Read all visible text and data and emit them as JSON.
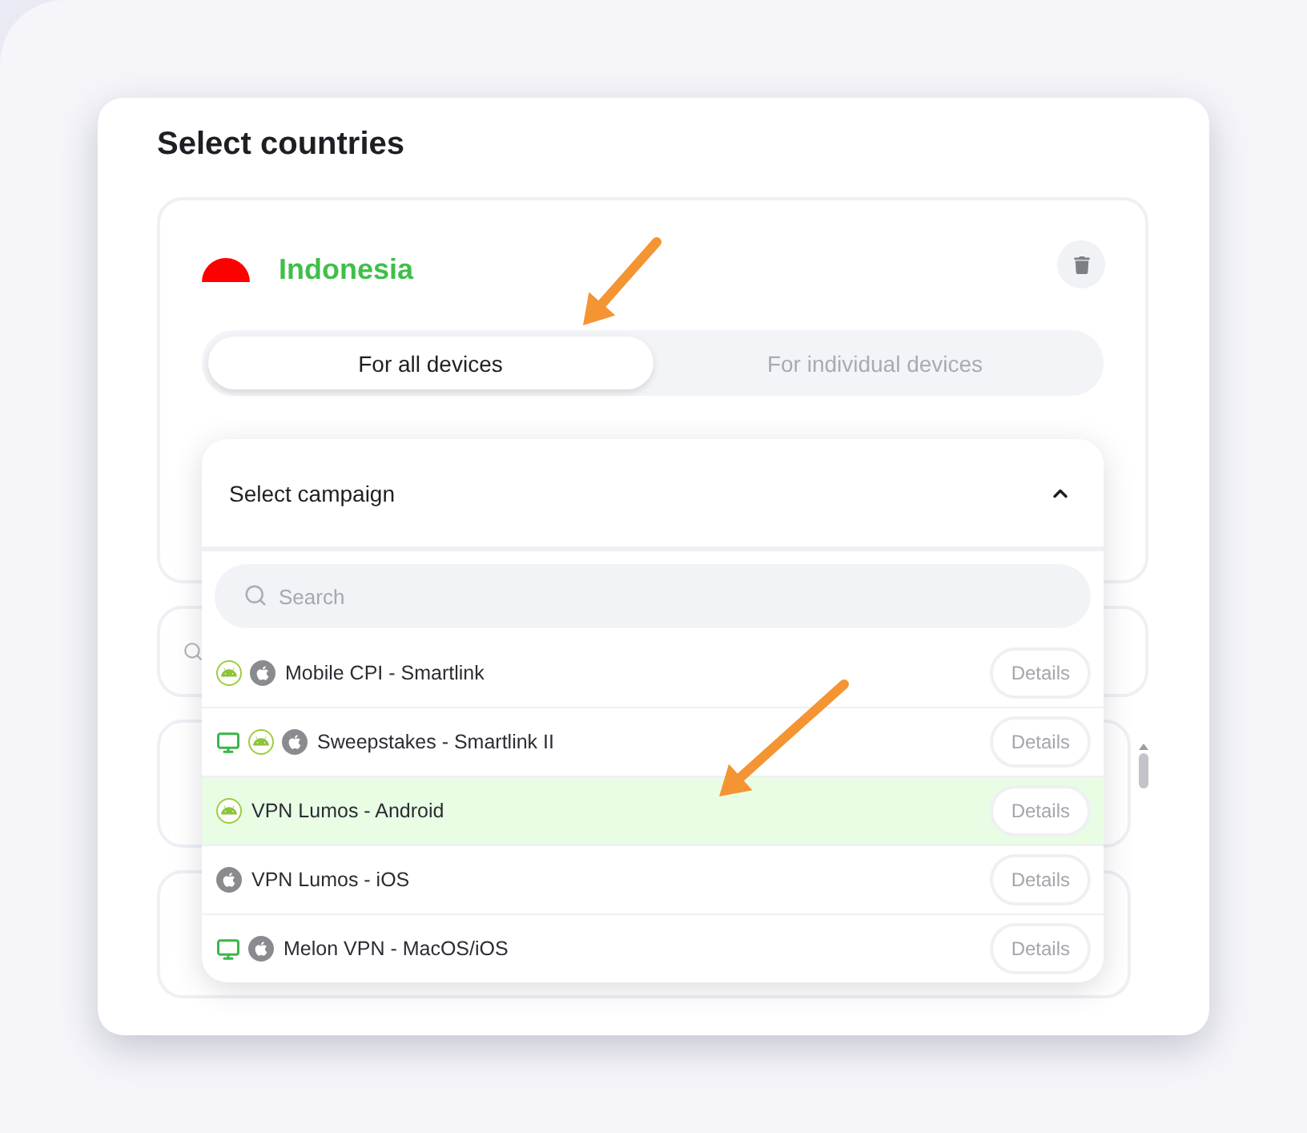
{
  "title": "Select countries",
  "country": {
    "name": "Indonesia",
    "flag": {
      "color": "#ff0000"
    }
  },
  "device_tabs": [
    {
      "label": "For all devices",
      "selected": true
    },
    {
      "label": "For individual devices",
      "selected": false
    }
  ],
  "campaign_select": {
    "label": "Select campaign",
    "expanded": true,
    "search": {
      "placeholder": "Search"
    },
    "items": [
      {
        "name": "Mobile CPI - Smartlink",
        "platforms": [
          {
            "kind": "android"
          },
          {
            "kind": "ios"
          }
        ],
        "selected": false,
        "button": "Details"
      },
      {
        "name": "Sweepstakes - Smartlink II",
        "platforms": [
          {
            "kind": "desktop"
          },
          {
            "kind": "android"
          },
          {
            "kind": "ios"
          }
        ],
        "selected": false,
        "button": "Details"
      },
      {
        "name": "VPN Lumos - Android",
        "platforms": [
          {
            "kind": "android"
          }
        ],
        "selected": true,
        "button": "Details"
      },
      {
        "name": "VPN Lumos - iOS",
        "platforms": [
          {
            "kind": "ios"
          }
        ],
        "selected": false,
        "button": "Details"
      },
      {
        "name": "Melon VPN - MacOS/iOS",
        "platforms": [
          {
            "kind": "desktop"
          },
          {
            "kind": "ios"
          }
        ],
        "selected": false,
        "button": "Details"
      }
    ]
  }
}
